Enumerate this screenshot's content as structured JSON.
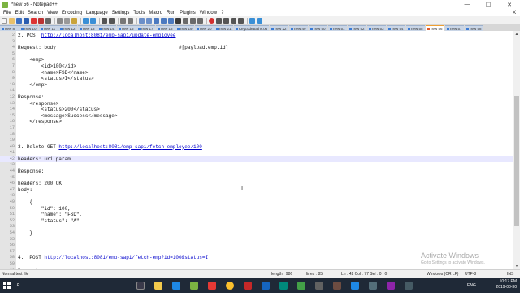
{
  "window": {
    "title": "*new 56 - Notepad++",
    "minimize": "—",
    "maximize": "☐",
    "close": "✕"
  },
  "menu": [
    "File",
    "Edit",
    "Search",
    "View",
    "Encoding",
    "Language",
    "Settings",
    "Tools",
    "Macro",
    "Run",
    "Plugins",
    "Window",
    "?"
  ],
  "menu_close": "X",
  "tabs": [
    "new 8",
    "new 10",
    "new 11",
    "new 12",
    "new 13",
    "new 14",
    "new 15",
    "new 17",
    "new 18",
    "new 19",
    "new 20",
    "new 21",
    "KeycodeBaths.txt",
    "new 22",
    "new 49",
    "new 50",
    "new 51",
    "new 52",
    "new 53",
    "new 54",
    "new 55",
    "new 56",
    "new 57",
    "new 58"
  ],
  "active_tab": "new 56",
  "editor": {
    "lines": [
      {
        "n": "2",
        "text": "2. POST ",
        "url": "http://localhost:8081/emp-sapi/update-employee",
        "after": ""
      },
      {
        "n": "3",
        "text": "",
        "url": "",
        "after": ""
      },
      {
        "n": "4",
        "text": "Request: body                                          #[payload.emp.id]",
        "url": "",
        "after": ""
      },
      {
        "n": "5",
        "text": "",
        "url": "",
        "after": ""
      },
      {
        "n": "6",
        "text": "    <emp>",
        "url": "",
        "after": ""
      },
      {
        "n": "7",
        "text": "        <id>100</id>",
        "url": "",
        "after": ""
      },
      {
        "n": "8",
        "text": "        <name>FSD</name>",
        "url": "",
        "after": ""
      },
      {
        "n": "9",
        "text": "        <status>I</status>",
        "url": "",
        "after": ""
      },
      {
        "n": "10",
        "text": "    </emp>",
        "url": "",
        "after": ""
      },
      {
        "n": "11",
        "text": "",
        "url": "",
        "after": ""
      },
      {
        "n": "12",
        "text": "Response:",
        "url": "",
        "after": ""
      },
      {
        "n": "13",
        "text": "    <response>",
        "url": "",
        "after": ""
      },
      {
        "n": "14",
        "text": "        <status>200</status>",
        "url": "",
        "after": ""
      },
      {
        "n": "15",
        "text": "        <message>Success</message>",
        "url": "",
        "after": ""
      },
      {
        "n": "16",
        "text": "    </response>",
        "url": "",
        "after": ""
      },
      {
        "n": "17",
        "text": "",
        "url": "",
        "after": ""
      },
      {
        "n": "18",
        "text": "",
        "url": "",
        "after": ""
      },
      {
        "n": "19",
        "text": "",
        "url": "",
        "after": ""
      },
      {
        "n": "40",
        "text": "3. Delete GET ",
        "url": "http://localhost:8081/emp-sapi/fetch-employee/100",
        "after": ""
      },
      {
        "n": "41",
        "text": "",
        "url": "",
        "after": ""
      },
      {
        "n": "42",
        "text": "headers: uri param",
        "url": "",
        "after": ""
      },
      {
        "n": "43",
        "text": "",
        "url": "",
        "after": ""
      },
      {
        "n": "44",
        "text": "Response:",
        "url": "",
        "after": ""
      },
      {
        "n": "45",
        "text": "",
        "url": "",
        "after": ""
      },
      {
        "n": "46",
        "text": "headers: 200 OK",
        "url": "",
        "after": ""
      },
      {
        "n": "47",
        "text": "body:",
        "url": "",
        "after": ""
      },
      {
        "n": "48",
        "text": "",
        "url": "",
        "after": ""
      },
      {
        "n": "49",
        "text": "    {",
        "url": "",
        "after": ""
      },
      {
        "n": "50",
        "text": "        \"id\": 100,",
        "url": "",
        "after": ""
      },
      {
        "n": "51",
        "text": "        \"name\": \"FSD\",",
        "url": "",
        "after": ""
      },
      {
        "n": "52",
        "text": "        \"status\": \"A\"",
        "url": "",
        "after": ""
      },
      {
        "n": "53",
        "text": "",
        "url": "",
        "after": ""
      },
      {
        "n": "54",
        "text": "    }",
        "url": "",
        "after": ""
      },
      {
        "n": "55",
        "text": "",
        "url": "",
        "after": ""
      },
      {
        "n": "56",
        "text": "",
        "url": "",
        "after": ""
      },
      {
        "n": "57",
        "text": "",
        "url": "",
        "after": ""
      },
      {
        "n": "58",
        "text": "4.  POST ",
        "url": "http://localhost:8081/emp-sapi/fetch-emp?id=100&status=I",
        "after": ""
      },
      {
        "n": "59",
        "text": "",
        "url": "",
        "after": ""
      },
      {
        "n": "60",
        "text": "Request:",
        "url": "",
        "after": ""
      }
    ],
    "current_line": "42"
  },
  "watermark": {
    "title": "Activate Windows",
    "subtitle": "Go to Settings to activate Windows."
  },
  "status": {
    "file_type": "Normal text file",
    "length": "length : 986",
    "lines": "lines : 85",
    "position": "Ln : 42    Col : 77    Sel : 0 | 0",
    "eol": "Windows (CR LF)",
    "encoding": "UTF-8",
    "mode": "INS"
  },
  "taskbar": {
    "lang": "ENG",
    "time": "10:17 PM",
    "date": "2019-08-30"
  },
  "colors": {
    "url": "#0000cc",
    "current_line_bg": "#e8e8ff",
    "taskbar_bg": "#1f2937"
  }
}
